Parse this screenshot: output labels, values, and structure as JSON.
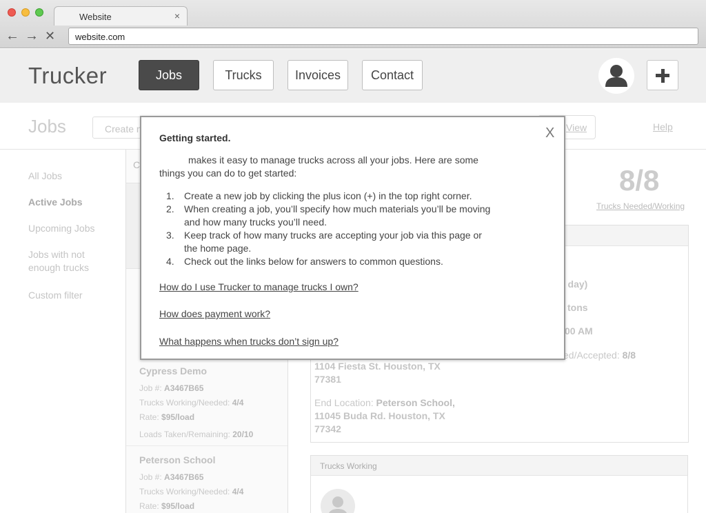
{
  "browser": {
    "tab_title": "Website",
    "tab_close": "×",
    "url": "website.com",
    "back": "←",
    "forward": "→",
    "stop": "✕"
  },
  "app": {
    "brand": "Trucker",
    "nav": [
      {
        "label": "Jobs",
        "active": true
      },
      {
        "label": "Trucks",
        "active": false
      },
      {
        "label": "Invoices",
        "active": false
      },
      {
        "label": "Contact",
        "active": false
      }
    ],
    "accent_dark": "#4a4a4a"
  },
  "subheader": {
    "title": "Jobs",
    "create_placeholder": "Create n",
    "view_label": "View",
    "help_label": "Help"
  },
  "sidebar": {
    "items": [
      {
        "label": "All Jobs",
        "active": false
      },
      {
        "label": "Active Jobs",
        "active": true
      },
      {
        "label": "Upcoming Jobs",
        "active": false
      },
      {
        "label": "Jobs with not enough trucks",
        "active": false
      },
      {
        "label": "Custom filter",
        "active": false
      }
    ]
  },
  "job_list": {
    "search_glyph": "C",
    "cards": [
      {
        "title": "Cypress Demo",
        "job_label": "Job #:",
        "job_value": "A3467B65",
        "trucks_label": "Trucks Working/Needed:",
        "trucks_value": "4/4",
        "rate_label": "Rate:",
        "rate_value": "$95/load",
        "loads_label": "Loads Taken/Remaining:",
        "loads_value": "20/10"
      },
      {
        "title": "Peterson School",
        "job_label": "Job #:",
        "job_value": "A3467B65",
        "trucks_label": "Trucks Working/Needed:",
        "trucks_value": "4/4",
        "rate_label": "Rate:",
        "rate_value": "$95/load"
      }
    ]
  },
  "detail": {
    "stat_value": "8/8",
    "stat_label": "Trucks Needed/Working",
    "frag_day": "( day)",
    "frag_tons": "tons",
    "frag_time": "00 AM",
    "frag_accepted_label": "ed/Accepted:",
    "frag_accepted_value": "8/8",
    "start_line1": "1104 Fiesta St. Houston, TX",
    "start_line2": "77381",
    "end_label": "End Location:",
    "end_line1": "Peterson School,",
    "end_line2": "11045 Buda Rd. Houston, TX",
    "end_line3": "77342",
    "trucks_working_title": "Trucks Working"
  },
  "modal": {
    "close": "X",
    "title": "Getting started.",
    "intro": "makes it easy to manage trucks across all your jobs. Here are some things you can do to get started:",
    "steps": [
      {
        "num": "1.",
        "text": "Create a new job by clicking the plus icon (+) in the top right corner."
      },
      {
        "num": "2.",
        "text": "When creating a job, you’ll specify how much materials you’ll be moving and how many trucks you’ll need."
      },
      {
        "num": "3.",
        "text": "Keep track of how many trucks are accepting your job via this page or the home page."
      },
      {
        "num": "4.",
        "text": "Check out the links below for answers to common questions."
      }
    ],
    "links": [
      "How do I use Trucker to manage trucks I own?",
      "How does payment work?",
      "What happens when trucks don’t sign up?"
    ]
  }
}
